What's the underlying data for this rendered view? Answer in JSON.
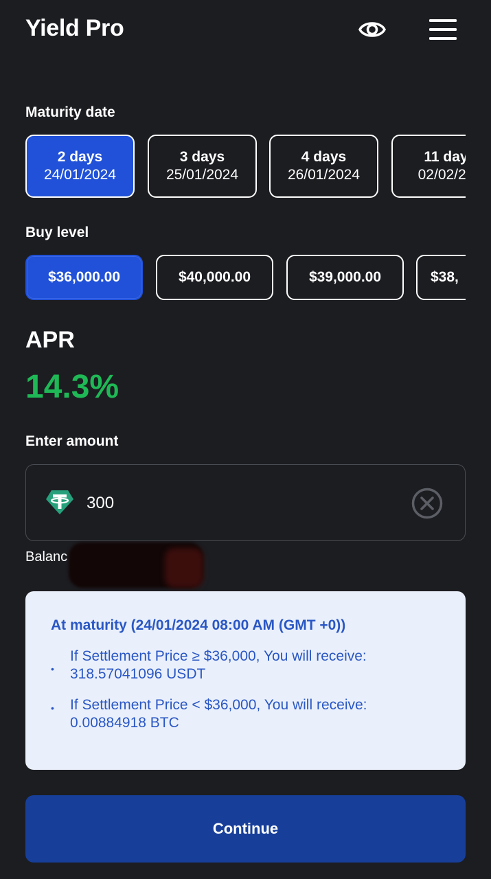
{
  "app": {
    "title": "Yield Pro"
  },
  "icons": {
    "visibility": "eye-icon",
    "menu": "menu-icon",
    "token": "usdt-icon",
    "clear": "close-circle-icon"
  },
  "colors": {
    "background": "#1c1d21",
    "accent": "#2051d8",
    "apr": "#1fb856",
    "card": "#eaf0fb",
    "card_text": "#2a57c4",
    "button": "#173f9a"
  },
  "maturity": {
    "label": "Maturity date",
    "options": [
      {
        "days": "2 days",
        "date": "24/01/2024",
        "selected": true
      },
      {
        "days": "3 days",
        "date": "25/01/2024",
        "selected": false
      },
      {
        "days": "4 days",
        "date": "26/01/2024",
        "selected": false
      },
      {
        "days": "11 day",
        "date": "02/02/20",
        "selected": false
      }
    ]
  },
  "buy_level": {
    "label": "Buy level",
    "options": [
      {
        "label": "$36,000.00",
        "selected": true
      },
      {
        "label": "$40,000.00",
        "selected": false
      },
      {
        "label": "$39,000.00",
        "selected": false
      },
      {
        "label": "$38,",
        "selected": false
      }
    ]
  },
  "apr": {
    "label": "APR",
    "value": "14.3%"
  },
  "amount": {
    "label": "Enter amount",
    "value": "300",
    "balance_label": "Balanc"
  },
  "info": {
    "title": "At maturity (24/01/2024 08:00 AM (GMT +0))",
    "items": [
      "If Settlement Price ≥ $36,000, You will receive: 318.57041096 USDT",
      "If Settlement Price < $36,000, You will receive: 0.00884918 BTC"
    ],
    "bullet": "•"
  },
  "actions": {
    "continue_label": "Continue"
  }
}
